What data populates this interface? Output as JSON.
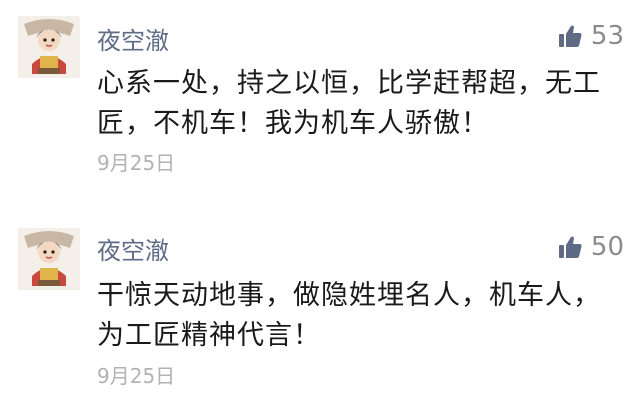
{
  "comments": [
    {
      "username": "夜空澈",
      "likes": "53",
      "text": "心系一处，持之以恒，比学赶帮超，无工匠，不机车！我为机车人骄傲！",
      "date": "9月25日",
      "like_icon": "thumbs-up-icon",
      "like_color": "#5f6b85"
    },
    {
      "username": "夜空澈",
      "likes": "50",
      "text": "干惊天动地事，做隐姓埋名人，机车人，为工匠精神代言！",
      "date": "9月25日",
      "like_icon": "thumbs-up-icon",
      "like_color": "#5f6b85"
    }
  ]
}
